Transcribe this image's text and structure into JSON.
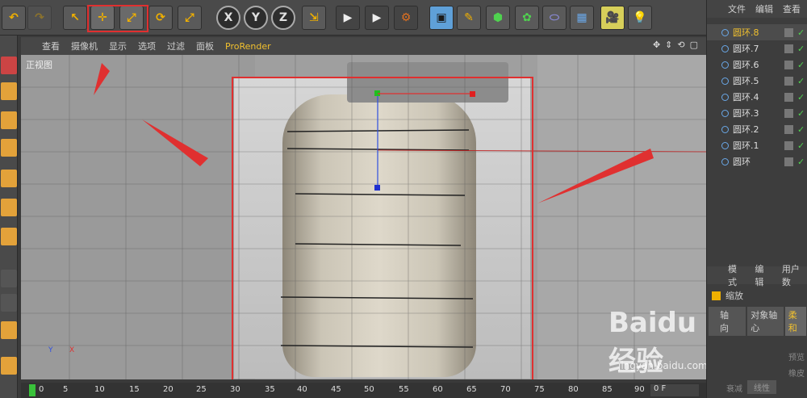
{
  "toolbar": {
    "undo_icon": "undo-icon",
    "redo_icon": "redo-icon",
    "tools": [
      {
        "name": "select-tool",
        "label": "↖"
      },
      {
        "name": "move-tool",
        "label": "✛"
      },
      {
        "name": "scale-tool",
        "label": "⤢"
      },
      {
        "name": "rotate-tool",
        "label": "⟳"
      },
      {
        "name": "last-tool",
        "label": "⤢"
      }
    ],
    "axes": [
      "X",
      "Y",
      "Z"
    ]
  },
  "menubar": {
    "items": [
      "查看",
      "摄像机",
      "显示",
      "选项",
      "过滤",
      "面板"
    ],
    "renderer": "ProRender"
  },
  "viewport": {
    "label": "正视图"
  },
  "objects_panel": {
    "menu": [
      "文件",
      "编辑",
      "查看"
    ],
    "items": [
      {
        "label": "圆环.8",
        "selected": true
      },
      {
        "label": "圆环.7"
      },
      {
        "label": "圆环.6"
      },
      {
        "label": "圆环.5"
      },
      {
        "label": "圆环.4"
      },
      {
        "label": "圆环.3"
      },
      {
        "label": "圆环.2"
      },
      {
        "label": "圆环.1"
      },
      {
        "label": "圆环"
      }
    ]
  },
  "attributes_panel": {
    "menu": [
      "模式",
      "编辑",
      "用户数"
    ],
    "title": "缩放",
    "tabs": [
      "轴向",
      "对象轴心",
      "柔和"
    ],
    "fields": [
      "预览",
      "橡皮",
      "衰减",
      "线性"
    ]
  },
  "timeline": {
    "ticks": [
      "0",
      "5",
      "10",
      "15",
      "20",
      "25",
      "30",
      "35",
      "40",
      "45",
      "50",
      "55",
      "60",
      "65",
      "70",
      "75",
      "80",
      "85",
      "90"
    ],
    "frame": "0 F"
  },
  "watermark": {
    "brand": "Baidu经验",
    "url": "jingyan.baidu.com"
  },
  "colors": {
    "accent": "#f0b000",
    "highlight": "#e03030",
    "check": "#4fd24f"
  }
}
